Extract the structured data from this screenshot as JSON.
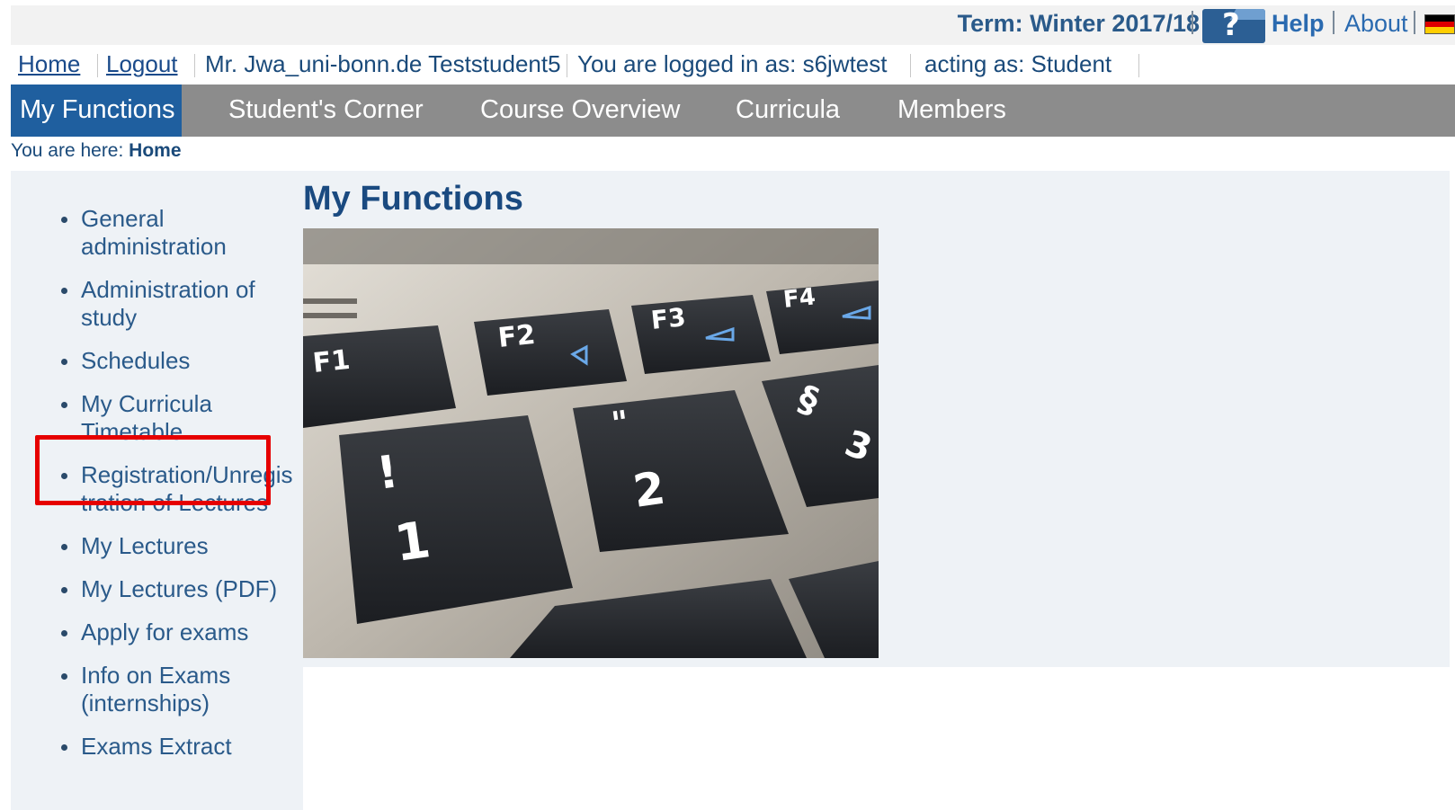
{
  "topbar": {
    "term": "Term: Winter 2017/18",
    "help": "Help",
    "about": "About",
    "help_icon_glyph": "?",
    "flag_icon": "german-flag-icon",
    "flag_colors": [
      "#000000",
      "#dd0000",
      "#ffce00"
    ]
  },
  "userline": {
    "home": "Home",
    "logout": "Logout",
    "name": "Mr. Jwa_uni-bonn.de Teststudent5",
    "logged_in": "You are logged in as: s6jwtest",
    "acting_as": "acting as: Student"
  },
  "nav": {
    "items": [
      "My Functions",
      "Student's Corner",
      "Course Overview",
      "Curricula",
      "Members"
    ],
    "active": "My Functions"
  },
  "breadcrumb": {
    "prefix": "You are here:",
    "current": "Home"
  },
  "sidebar": {
    "items": [
      "General administration",
      "Administration of study",
      "Schedules",
      "My Curricula Timetable",
      "Registration/Unregistration of Lectures",
      "My Lectures",
      "My Lectures (PDF)",
      "Apply for exams",
      "Info on Exams (internships)",
      "Exams Extract"
    ],
    "highlighted": "Administration of study"
  },
  "main": {
    "title": "My Functions",
    "image": {
      "keys": [
        "F1",
        "F2",
        "F3",
        "F4",
        "1",
        "!",
        "2",
        "\"",
        "§",
        "3"
      ]
    }
  },
  "colors": {
    "nav_bg": "#8c8c8c",
    "nav_active": "#1f5f9f",
    "link": "#1a4a7a",
    "highlight_border": "#e60000",
    "panel_bg": "#eef2f6"
  }
}
